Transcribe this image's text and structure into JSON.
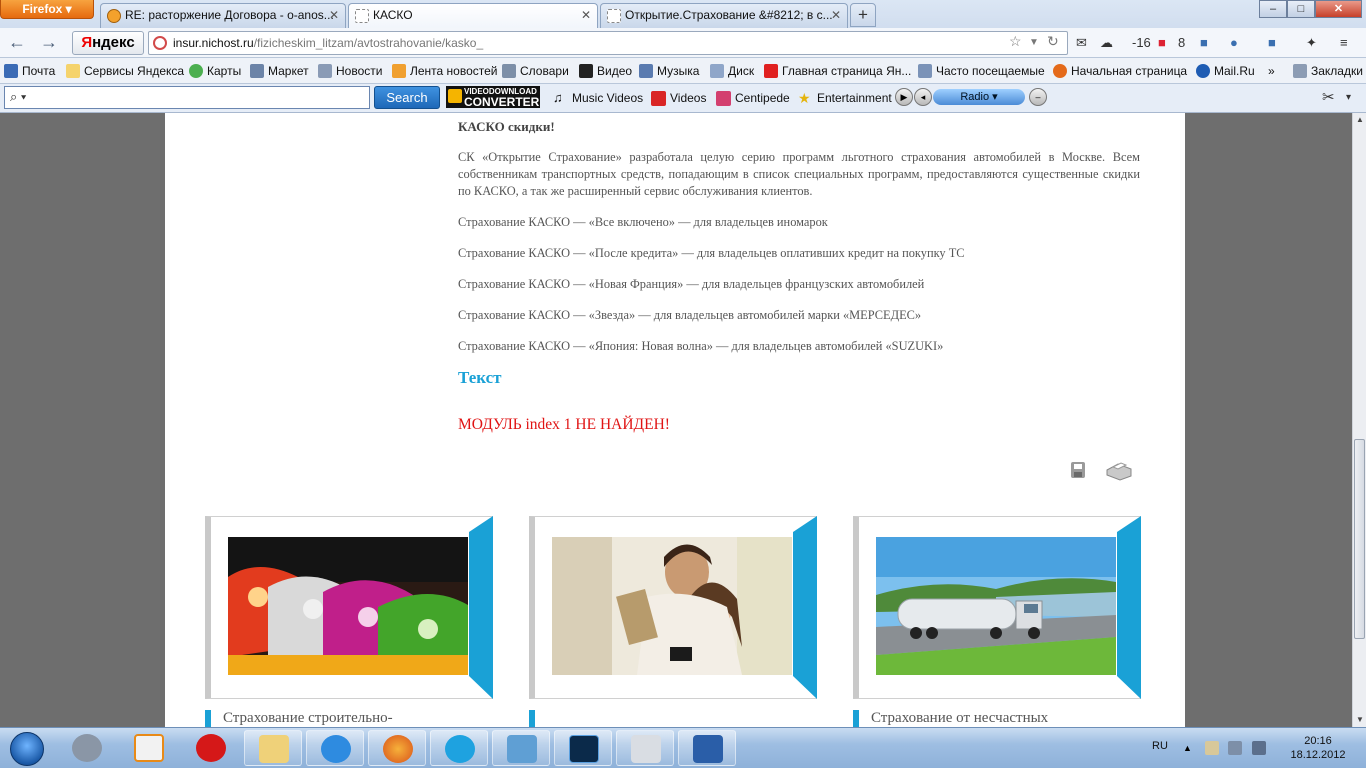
{
  "browser": {
    "menu_label": "Firefox",
    "tabs": [
      {
        "title": "RE: расторжение Договора - o-anos...",
        "active": false
      },
      {
        "title": "КАСКО",
        "active": true
      },
      {
        "title": "Открытие.Страхование &#8212; в с...",
        "active": false
      }
    ],
    "new_tab": "+",
    "window_controls": {
      "min": "–",
      "max": "□",
      "close": "✕"
    },
    "yandex_button": "Яндекс",
    "url_host": "insur.nichost.ru",
    "url_path": "/fizicheskim_litzam/avtostrahovanie/kasko_",
    "weather": "-16",
    "badge_count": "8",
    "bookmarks": [
      "Почта",
      "Сервисы Яндекса",
      "Карты",
      "Маркет",
      "Новости",
      "Лента новостей",
      "Словари",
      "Видео",
      "Музыка",
      "Диск",
      "Главная страница Ян...",
      "Часто посещаемые",
      "Начальная страница",
      "Mail.Ru"
    ],
    "bookmarks_more": "»",
    "bookmarks_folder": "Закладки",
    "yabar": {
      "search_button": "Search",
      "vdc_top": "VIDEODOWNLOAD",
      "vdc_bottom": "CONVERTER",
      "links": [
        "Music Videos",
        "Videos",
        "Centipede",
        "Entertainment"
      ],
      "radio_label": "Radio"
    }
  },
  "page": {
    "heading": "КАСКО скидки!",
    "intro": "СК «Открытие Страхование» разработала целую серию программ льготного страхования автомобилей в Москве. Всем собственникам транспортных средств, попадающим в список специальных программ, предоставляются существенные скидки по КАСКО, а так же расширенный сервис обслуживания клиентов.",
    "programs": [
      "Страхование КАСКО — «Все включено» — для владельцев иномарок",
      "Страхование КАСКО — «После кредита» — для владельцев оплативших кредит на покупку ТС",
      "Страхование КАСКО — «Новая Франция» — для владельцев французских автомобилей",
      "Страхование КАСКО — «Звезда» — для владельцев автомобилей марки «МЕРСЕДЕС»",
      "Страхование КАСКО — «Япония: Новая волна» — для владельцев автомобилей «SUZUKI»"
    ],
    "text_heading": "Текст",
    "module_error": "МОДУЛЬ index 1 НЕ НАЙДЕН!",
    "cards": [
      {
        "caption": "Страхование строительно-"
      },
      {
        "caption": ""
      },
      {
        "caption": "Страхование от несчастных"
      }
    ],
    "accent_color": "#1aa1d6",
    "error_color": "#e01414"
  },
  "taskbar": {
    "lang": "RU",
    "time": "20:16",
    "date": "18.12.2012"
  }
}
